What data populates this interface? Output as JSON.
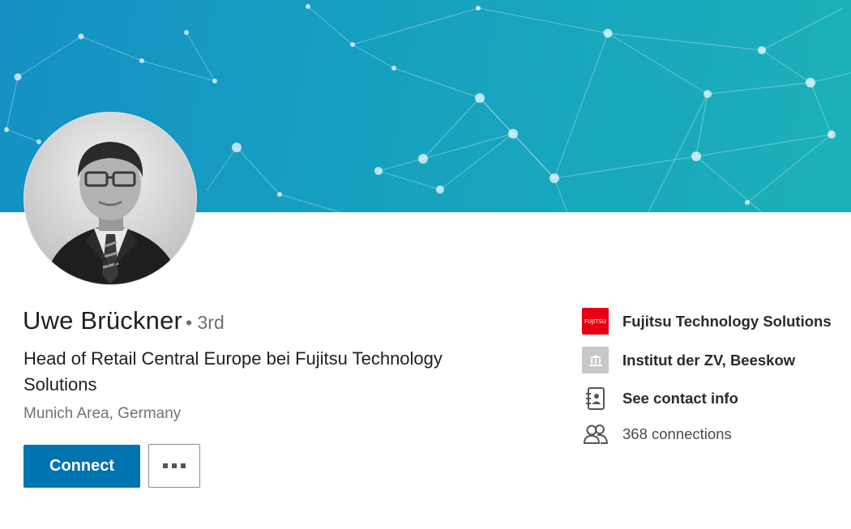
{
  "profile": {
    "name": "Uwe Brückner",
    "degree": "• 3rd",
    "headline": "Head of Retail Central Europe bei Fujitsu Technology Solutions",
    "location": "Munich Area, Germany",
    "avatar_icon": "profile-photo"
  },
  "actions": {
    "connect_label": "Connect",
    "more_icon": "more-dots-icon"
  },
  "sidebar": {
    "company": {
      "label": "Fujitsu Technology Solutions",
      "logo_text": "FUJITSU",
      "logo_color": "#e60012"
    },
    "school": {
      "label": "Institut der ZV, Beeskow",
      "icon": "school-icon"
    },
    "contact": {
      "label": "See contact info",
      "icon": "contact-card-icon"
    },
    "connections": {
      "label": "368 connections",
      "icon": "people-icon"
    }
  },
  "colors": {
    "primary_button": "#0073b1",
    "banner_start": "#1590c4",
    "banner_end": "#1cb1b8"
  }
}
